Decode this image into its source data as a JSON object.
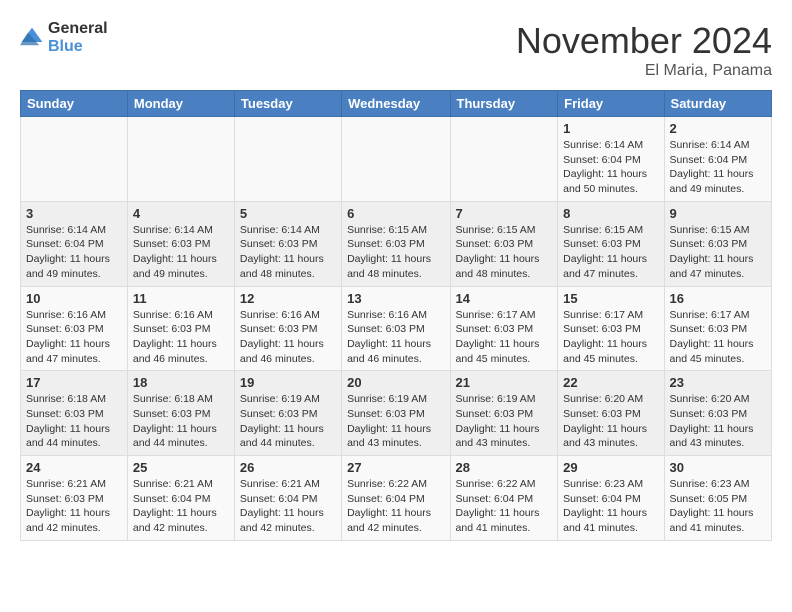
{
  "logo": {
    "general": "General",
    "blue": "Blue"
  },
  "header": {
    "month": "November 2024",
    "location": "El Maria, Panama"
  },
  "days_of_week": [
    "Sunday",
    "Monday",
    "Tuesday",
    "Wednesday",
    "Thursday",
    "Friday",
    "Saturday"
  ],
  "weeks": [
    [
      {
        "day": "",
        "info": ""
      },
      {
        "day": "",
        "info": ""
      },
      {
        "day": "",
        "info": ""
      },
      {
        "day": "",
        "info": ""
      },
      {
        "day": "",
        "info": ""
      },
      {
        "day": "1",
        "info": "Sunrise: 6:14 AM\nSunset: 6:04 PM\nDaylight: 11 hours and 50 minutes."
      },
      {
        "day": "2",
        "info": "Sunrise: 6:14 AM\nSunset: 6:04 PM\nDaylight: 11 hours and 49 minutes."
      }
    ],
    [
      {
        "day": "3",
        "info": "Sunrise: 6:14 AM\nSunset: 6:04 PM\nDaylight: 11 hours and 49 minutes."
      },
      {
        "day": "4",
        "info": "Sunrise: 6:14 AM\nSunset: 6:03 PM\nDaylight: 11 hours and 49 minutes."
      },
      {
        "day": "5",
        "info": "Sunrise: 6:14 AM\nSunset: 6:03 PM\nDaylight: 11 hours and 48 minutes."
      },
      {
        "day": "6",
        "info": "Sunrise: 6:15 AM\nSunset: 6:03 PM\nDaylight: 11 hours and 48 minutes."
      },
      {
        "day": "7",
        "info": "Sunrise: 6:15 AM\nSunset: 6:03 PM\nDaylight: 11 hours and 48 minutes."
      },
      {
        "day": "8",
        "info": "Sunrise: 6:15 AM\nSunset: 6:03 PM\nDaylight: 11 hours and 47 minutes."
      },
      {
        "day": "9",
        "info": "Sunrise: 6:15 AM\nSunset: 6:03 PM\nDaylight: 11 hours and 47 minutes."
      }
    ],
    [
      {
        "day": "10",
        "info": "Sunrise: 6:16 AM\nSunset: 6:03 PM\nDaylight: 11 hours and 47 minutes."
      },
      {
        "day": "11",
        "info": "Sunrise: 6:16 AM\nSunset: 6:03 PM\nDaylight: 11 hours and 46 minutes."
      },
      {
        "day": "12",
        "info": "Sunrise: 6:16 AM\nSunset: 6:03 PM\nDaylight: 11 hours and 46 minutes."
      },
      {
        "day": "13",
        "info": "Sunrise: 6:16 AM\nSunset: 6:03 PM\nDaylight: 11 hours and 46 minutes."
      },
      {
        "day": "14",
        "info": "Sunrise: 6:17 AM\nSunset: 6:03 PM\nDaylight: 11 hours and 45 minutes."
      },
      {
        "day": "15",
        "info": "Sunrise: 6:17 AM\nSunset: 6:03 PM\nDaylight: 11 hours and 45 minutes."
      },
      {
        "day": "16",
        "info": "Sunrise: 6:17 AM\nSunset: 6:03 PM\nDaylight: 11 hours and 45 minutes."
      }
    ],
    [
      {
        "day": "17",
        "info": "Sunrise: 6:18 AM\nSunset: 6:03 PM\nDaylight: 11 hours and 44 minutes."
      },
      {
        "day": "18",
        "info": "Sunrise: 6:18 AM\nSunset: 6:03 PM\nDaylight: 11 hours and 44 minutes."
      },
      {
        "day": "19",
        "info": "Sunrise: 6:19 AM\nSunset: 6:03 PM\nDaylight: 11 hours and 44 minutes."
      },
      {
        "day": "20",
        "info": "Sunrise: 6:19 AM\nSunset: 6:03 PM\nDaylight: 11 hours and 43 minutes."
      },
      {
        "day": "21",
        "info": "Sunrise: 6:19 AM\nSunset: 6:03 PM\nDaylight: 11 hours and 43 minutes."
      },
      {
        "day": "22",
        "info": "Sunrise: 6:20 AM\nSunset: 6:03 PM\nDaylight: 11 hours and 43 minutes."
      },
      {
        "day": "23",
        "info": "Sunrise: 6:20 AM\nSunset: 6:03 PM\nDaylight: 11 hours and 43 minutes."
      }
    ],
    [
      {
        "day": "24",
        "info": "Sunrise: 6:21 AM\nSunset: 6:03 PM\nDaylight: 11 hours and 42 minutes."
      },
      {
        "day": "25",
        "info": "Sunrise: 6:21 AM\nSunset: 6:04 PM\nDaylight: 11 hours and 42 minutes."
      },
      {
        "day": "26",
        "info": "Sunrise: 6:21 AM\nSunset: 6:04 PM\nDaylight: 11 hours and 42 minutes."
      },
      {
        "day": "27",
        "info": "Sunrise: 6:22 AM\nSunset: 6:04 PM\nDaylight: 11 hours and 42 minutes."
      },
      {
        "day": "28",
        "info": "Sunrise: 6:22 AM\nSunset: 6:04 PM\nDaylight: 11 hours and 41 minutes."
      },
      {
        "day": "29",
        "info": "Sunrise: 6:23 AM\nSunset: 6:04 PM\nDaylight: 11 hours and 41 minutes."
      },
      {
        "day": "30",
        "info": "Sunrise: 6:23 AM\nSunset: 6:05 PM\nDaylight: 11 hours and 41 minutes."
      }
    ]
  ]
}
